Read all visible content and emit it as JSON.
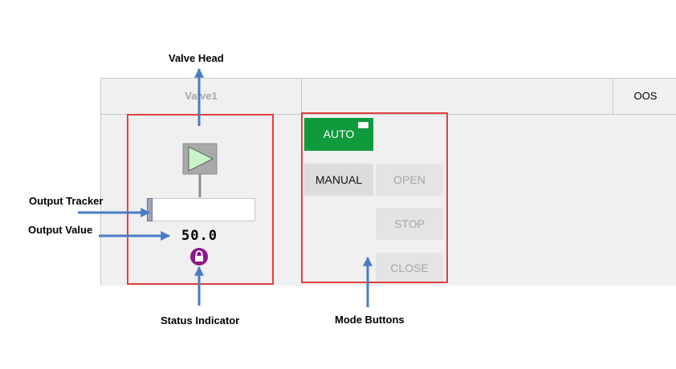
{
  "annotations": {
    "valve_head": "Valve Head",
    "output_tracker": "Output Tracker",
    "output_value": "Output Value",
    "status_indicator": "Status Indicator",
    "mode_buttons": "Mode Buttons"
  },
  "header": {
    "title": "Valve1",
    "mode_status": "OOS"
  },
  "faceplate": {
    "output_value": "50.0",
    "output_fraction": 0.0
  },
  "mode_buttons": {
    "auto": "AUTO",
    "manual": "MANUAL",
    "open": "OPEN",
    "stop": "STOP",
    "close": "CLOSE"
  },
  "colors": {
    "auto_active": "#0f9a3c",
    "highlight_box": "#e04040",
    "arrow": "#4a7cc4",
    "status_indicator": "#8b1a8b",
    "valve_head_fill": "#c8f5c8"
  },
  "icons": {
    "valve_head": "triangle-play-icon",
    "status": "lock-icon"
  }
}
